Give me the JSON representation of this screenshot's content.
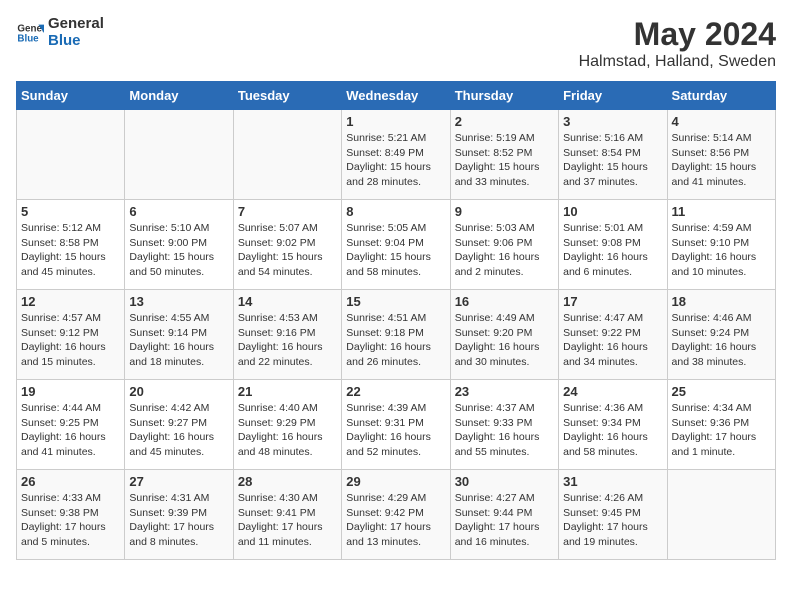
{
  "logo": {
    "line1": "General",
    "line2": "Blue"
  },
  "title": "May 2024",
  "subtitle": "Halmstad, Halland, Sweden",
  "headers": [
    "Sunday",
    "Monday",
    "Tuesday",
    "Wednesday",
    "Thursday",
    "Friday",
    "Saturday"
  ],
  "weeks": [
    [
      {
        "num": "",
        "info": ""
      },
      {
        "num": "",
        "info": ""
      },
      {
        "num": "",
        "info": ""
      },
      {
        "num": "1",
        "info": "Sunrise: 5:21 AM\nSunset: 8:49 PM\nDaylight: 15 hours and 28 minutes."
      },
      {
        "num": "2",
        "info": "Sunrise: 5:19 AM\nSunset: 8:52 PM\nDaylight: 15 hours and 33 minutes."
      },
      {
        "num": "3",
        "info": "Sunrise: 5:16 AM\nSunset: 8:54 PM\nDaylight: 15 hours and 37 minutes."
      },
      {
        "num": "4",
        "info": "Sunrise: 5:14 AM\nSunset: 8:56 PM\nDaylight: 15 hours and 41 minutes."
      }
    ],
    [
      {
        "num": "5",
        "info": "Sunrise: 5:12 AM\nSunset: 8:58 PM\nDaylight: 15 hours and 45 minutes."
      },
      {
        "num": "6",
        "info": "Sunrise: 5:10 AM\nSunset: 9:00 PM\nDaylight: 15 hours and 50 minutes."
      },
      {
        "num": "7",
        "info": "Sunrise: 5:07 AM\nSunset: 9:02 PM\nDaylight: 15 hours and 54 minutes."
      },
      {
        "num": "8",
        "info": "Sunrise: 5:05 AM\nSunset: 9:04 PM\nDaylight: 15 hours and 58 minutes."
      },
      {
        "num": "9",
        "info": "Sunrise: 5:03 AM\nSunset: 9:06 PM\nDaylight: 16 hours and 2 minutes."
      },
      {
        "num": "10",
        "info": "Sunrise: 5:01 AM\nSunset: 9:08 PM\nDaylight: 16 hours and 6 minutes."
      },
      {
        "num": "11",
        "info": "Sunrise: 4:59 AM\nSunset: 9:10 PM\nDaylight: 16 hours and 10 minutes."
      }
    ],
    [
      {
        "num": "12",
        "info": "Sunrise: 4:57 AM\nSunset: 9:12 PM\nDaylight: 16 hours and 15 minutes."
      },
      {
        "num": "13",
        "info": "Sunrise: 4:55 AM\nSunset: 9:14 PM\nDaylight: 16 hours and 18 minutes."
      },
      {
        "num": "14",
        "info": "Sunrise: 4:53 AM\nSunset: 9:16 PM\nDaylight: 16 hours and 22 minutes."
      },
      {
        "num": "15",
        "info": "Sunrise: 4:51 AM\nSunset: 9:18 PM\nDaylight: 16 hours and 26 minutes."
      },
      {
        "num": "16",
        "info": "Sunrise: 4:49 AM\nSunset: 9:20 PM\nDaylight: 16 hours and 30 minutes."
      },
      {
        "num": "17",
        "info": "Sunrise: 4:47 AM\nSunset: 9:22 PM\nDaylight: 16 hours and 34 minutes."
      },
      {
        "num": "18",
        "info": "Sunrise: 4:46 AM\nSunset: 9:24 PM\nDaylight: 16 hours and 38 minutes."
      }
    ],
    [
      {
        "num": "19",
        "info": "Sunrise: 4:44 AM\nSunset: 9:25 PM\nDaylight: 16 hours and 41 minutes."
      },
      {
        "num": "20",
        "info": "Sunrise: 4:42 AM\nSunset: 9:27 PM\nDaylight: 16 hours and 45 minutes."
      },
      {
        "num": "21",
        "info": "Sunrise: 4:40 AM\nSunset: 9:29 PM\nDaylight: 16 hours and 48 minutes."
      },
      {
        "num": "22",
        "info": "Sunrise: 4:39 AM\nSunset: 9:31 PM\nDaylight: 16 hours and 52 minutes."
      },
      {
        "num": "23",
        "info": "Sunrise: 4:37 AM\nSunset: 9:33 PM\nDaylight: 16 hours and 55 minutes."
      },
      {
        "num": "24",
        "info": "Sunrise: 4:36 AM\nSunset: 9:34 PM\nDaylight: 16 hours and 58 minutes."
      },
      {
        "num": "25",
        "info": "Sunrise: 4:34 AM\nSunset: 9:36 PM\nDaylight: 17 hours and 1 minute."
      }
    ],
    [
      {
        "num": "26",
        "info": "Sunrise: 4:33 AM\nSunset: 9:38 PM\nDaylight: 17 hours and 5 minutes."
      },
      {
        "num": "27",
        "info": "Sunrise: 4:31 AM\nSunset: 9:39 PM\nDaylight: 17 hours and 8 minutes."
      },
      {
        "num": "28",
        "info": "Sunrise: 4:30 AM\nSunset: 9:41 PM\nDaylight: 17 hours and 11 minutes."
      },
      {
        "num": "29",
        "info": "Sunrise: 4:29 AM\nSunset: 9:42 PM\nDaylight: 17 hours and 13 minutes."
      },
      {
        "num": "30",
        "info": "Sunrise: 4:27 AM\nSunset: 9:44 PM\nDaylight: 17 hours and 16 minutes."
      },
      {
        "num": "31",
        "info": "Sunrise: 4:26 AM\nSunset: 9:45 PM\nDaylight: 17 hours and 19 minutes."
      },
      {
        "num": "",
        "info": ""
      }
    ]
  ]
}
